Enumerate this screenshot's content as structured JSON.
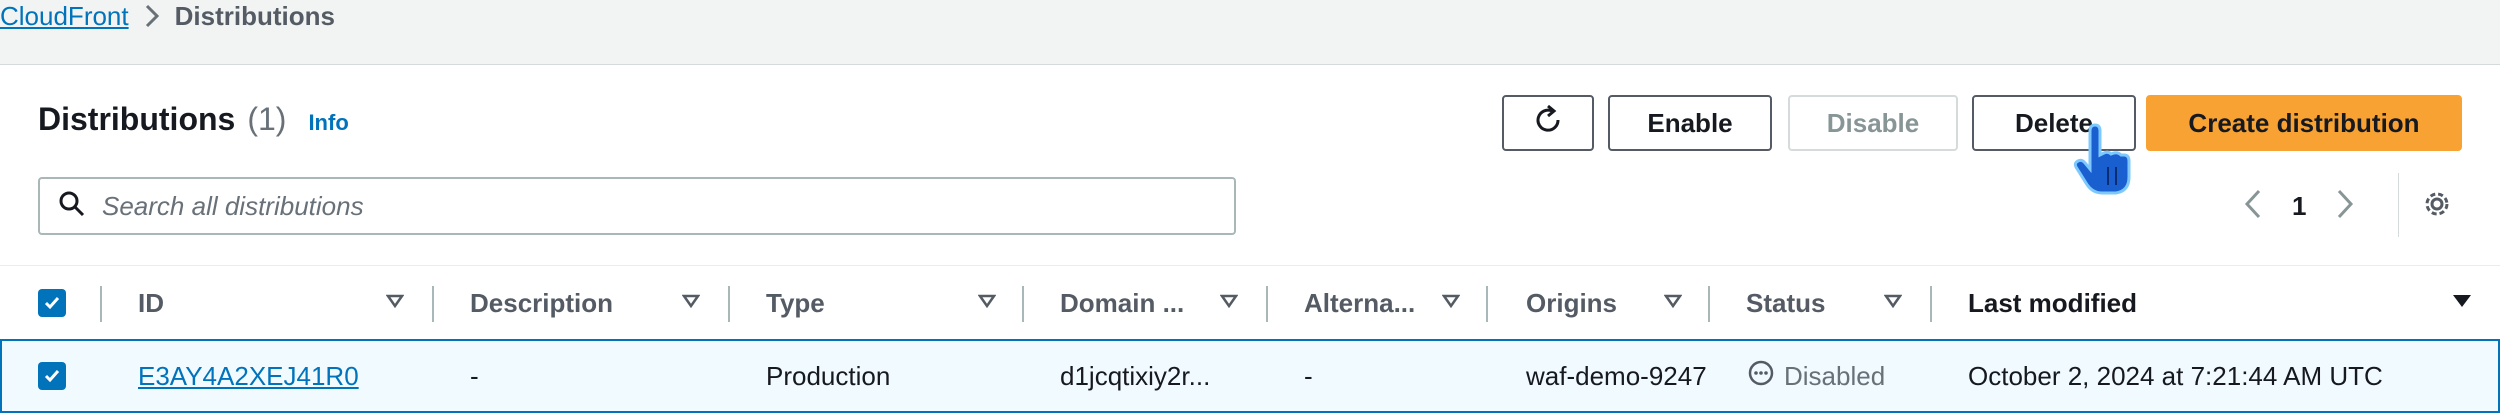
{
  "breadcrumb": {
    "root": "CloudFront",
    "current": "Distributions"
  },
  "header": {
    "title": "Distributions",
    "count": "(1)",
    "info": "Info"
  },
  "toolbar": {
    "enable_label": "Enable",
    "disable_label": "Disable",
    "delete_label": "Delete",
    "create_label": "Create distribution"
  },
  "search": {
    "placeholder": "Search all distributions",
    "value": ""
  },
  "pagination": {
    "current_page": "1"
  },
  "table": {
    "columns": [
      "ID",
      "Description",
      "Type",
      "Domain ...",
      "Alterna...",
      "Origins",
      "Status",
      "Last modified"
    ],
    "rows": [
      {
        "id": "E3AY4A2XEJ41R0",
        "description": "-",
        "type": "Production",
        "domain": "d1jcqtixiy2r...",
        "alternate": "-",
        "origins": "waf-demo-9247",
        "status": "Disabled",
        "last_modified": "October 2, 2024 at 7:21:44 AM UTC"
      }
    ]
  },
  "icons": {
    "breadcrumb_separator": "chevron-right-icon",
    "refresh": "refresh-icon",
    "search": "search-icon",
    "prev": "chevron-left-icon",
    "next": "chevron-right-icon",
    "settings": "gear-icon",
    "sort": "sort-down-icon",
    "status": "ellipsis-circle-icon",
    "cursor": "hand-pointer-icon"
  },
  "colors": {
    "link": "#0073bb",
    "primary_button": "#f7a233",
    "selected_row_bg": "#f1faff",
    "selected_row_border": "#0073bb",
    "page_bg": "#f2f3f3"
  }
}
